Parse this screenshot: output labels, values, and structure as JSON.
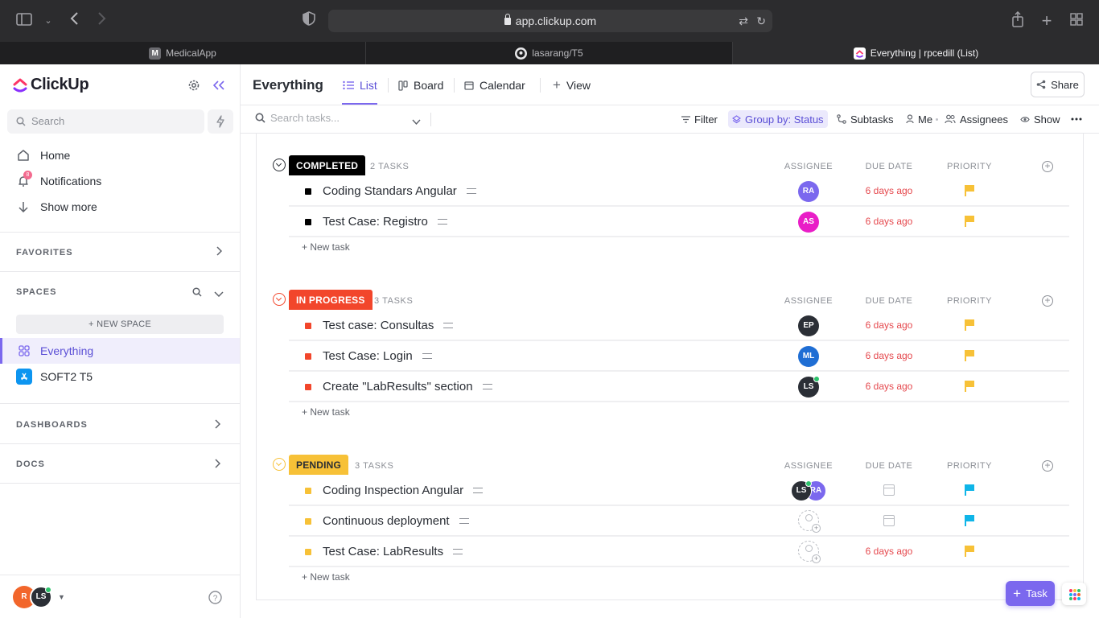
{
  "browser": {
    "url": "app.clickup.com",
    "tabs": [
      {
        "label": "MedicalApp",
        "favicon": "M"
      },
      {
        "label": "lasarang/T5",
        "favicon": "github-icon"
      },
      {
        "label": "Everything | rpcedill (List)",
        "favicon": "clickup-icon"
      }
    ]
  },
  "sidebar": {
    "brand": "ClickUp",
    "search_placeholder": "Search",
    "nav": [
      {
        "label": "Home",
        "icon": "home-icon"
      },
      {
        "label": "Notifications",
        "icon": "bell-icon",
        "badge": "8"
      },
      {
        "label": "Show more",
        "icon": "arrow-down-icon"
      }
    ],
    "favorites_label": "FAVORITES",
    "spaces_label": "SPACES",
    "new_space_label": "+ NEW SPACE",
    "spaces": [
      {
        "label": "Everything",
        "active": true
      },
      {
        "label": "SOFT2 T5",
        "active": false
      }
    ],
    "dashboards_label": "DASHBOARDS",
    "docs_label": "DOCS",
    "footer_avatars": [
      "R",
      "LS"
    ]
  },
  "header": {
    "title": "Everything",
    "views": [
      {
        "label": "List",
        "active": true
      },
      {
        "label": "Board",
        "active": false
      },
      {
        "label": "Calendar",
        "active": false
      }
    ],
    "add_view_label": "View",
    "share_label": "Share"
  },
  "toolbar": {
    "search_placeholder": "Search tasks...",
    "filter_label": "Filter",
    "group_by_label": "Group by: Status",
    "subtasks_label": "Subtasks",
    "me_label": "Me",
    "assignees_label": "Assignees",
    "show_label": "Show"
  },
  "columns": {
    "assignee": "ASSIGNEE",
    "due_date": "DUE DATE",
    "priority": "PRIORITY"
  },
  "new_task_label": "+ New task",
  "groups": [
    {
      "status": "COMPLETED",
      "count_label": "2 TASKS",
      "color": "#000000",
      "tasks": [
        {
          "name": "Coding Standars Angular",
          "assignees": [
            "RA"
          ],
          "due": "6 days ago",
          "priority": "normal"
        },
        {
          "name": "Test Case: Registro",
          "assignees": [
            "AS"
          ],
          "due": "6 days ago",
          "priority": "normal"
        }
      ]
    },
    {
      "status": "IN PROGRESS",
      "count_label": "3 TASKS",
      "color": "#f2462b",
      "tasks": [
        {
          "name": "Test case: Consultas",
          "assignees": [
            "EP"
          ],
          "due": "6 days ago",
          "priority": "normal"
        },
        {
          "name": "Test Case: Login",
          "assignees": [
            "ML"
          ],
          "due": "6 days ago",
          "priority": "normal"
        },
        {
          "name": "Create \"LabResults\" section",
          "assignees": [
            "LS"
          ],
          "due": "6 days ago",
          "priority": "normal"
        }
      ]
    },
    {
      "status": "PENDING",
      "count_label": "3 TASKS",
      "color": "#f7c137",
      "tasks": [
        {
          "name": "Coding Inspection Angular",
          "assignees": [
            "LS",
            "RA"
          ],
          "due": "",
          "priority": "low"
        },
        {
          "name": "Continuous deployment",
          "assignees": [],
          "due": "",
          "priority": "low"
        },
        {
          "name": "Test Case: LabResults",
          "assignees": [],
          "due": "6 days ago",
          "priority": "normal"
        }
      ]
    }
  ],
  "fab": {
    "task_label": "Task"
  },
  "colors": {
    "accent": "#7b68ee",
    "overdue": "#e5484d",
    "flag_normal": "#f7c137",
    "flag_low": "#0fb5e8"
  }
}
